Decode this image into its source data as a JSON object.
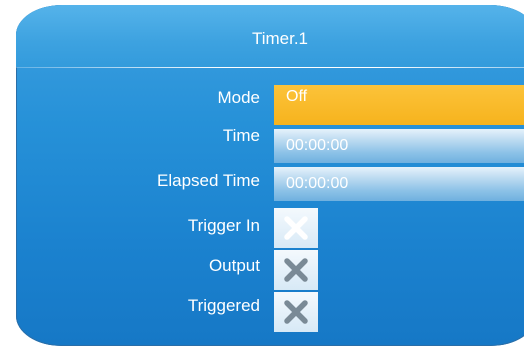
{
  "title": "Timer.1",
  "fields": {
    "mode": {
      "label": "Mode",
      "value": "Off"
    },
    "time": {
      "label": "Time",
      "value": "00:00:00"
    },
    "elapsed": {
      "label": "Elapsed Time",
      "value": "00:00:00"
    },
    "trigger_in": {
      "label": "Trigger In",
      "state": false,
      "icon": "cross-icon-active"
    },
    "output": {
      "label": "Output",
      "state": false,
      "icon": "cross-icon-disabled"
    },
    "triggered": {
      "label": "Triggered",
      "state": false,
      "icon": "cross-icon-disabled"
    }
  },
  "colors": {
    "panel": "#2691d8",
    "mode_field": "#f6b31d",
    "cross_active": "#ffffff",
    "cross_disabled": "#7a8a96"
  }
}
